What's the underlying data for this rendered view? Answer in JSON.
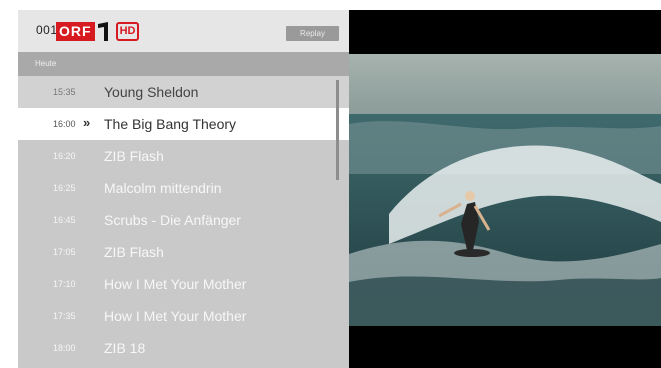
{
  "header": {
    "channel_number": "001",
    "channel_logo_text": "ORF",
    "hd_badge": "HD",
    "replay_button": "Replay"
  },
  "day_label": "Heute",
  "selected_marker": "»",
  "programs": [
    {
      "time": "15:35",
      "title": "Young Sheldon"
    },
    {
      "time": "16:00",
      "title": "The Big Bang Theory"
    },
    {
      "time": "16:20",
      "title": "ZIB Flash"
    },
    {
      "time": "16:25",
      "title": "Malcolm mittendrin"
    },
    {
      "time": "16:45",
      "title": "Scrubs - Die Anfänger"
    },
    {
      "time": "17:05",
      "title": "ZIB Flash"
    },
    {
      "time": "17:10",
      "title": "How I Met Your Mother"
    },
    {
      "time": "17:35",
      "title": "How I Met Your Mother"
    },
    {
      "time": "18:00",
      "title": "ZIB 18"
    }
  ],
  "colors": {
    "brand_red": "#d71920",
    "panel_bg": "#c9c9c9",
    "selected_bg": "#ffffff"
  }
}
